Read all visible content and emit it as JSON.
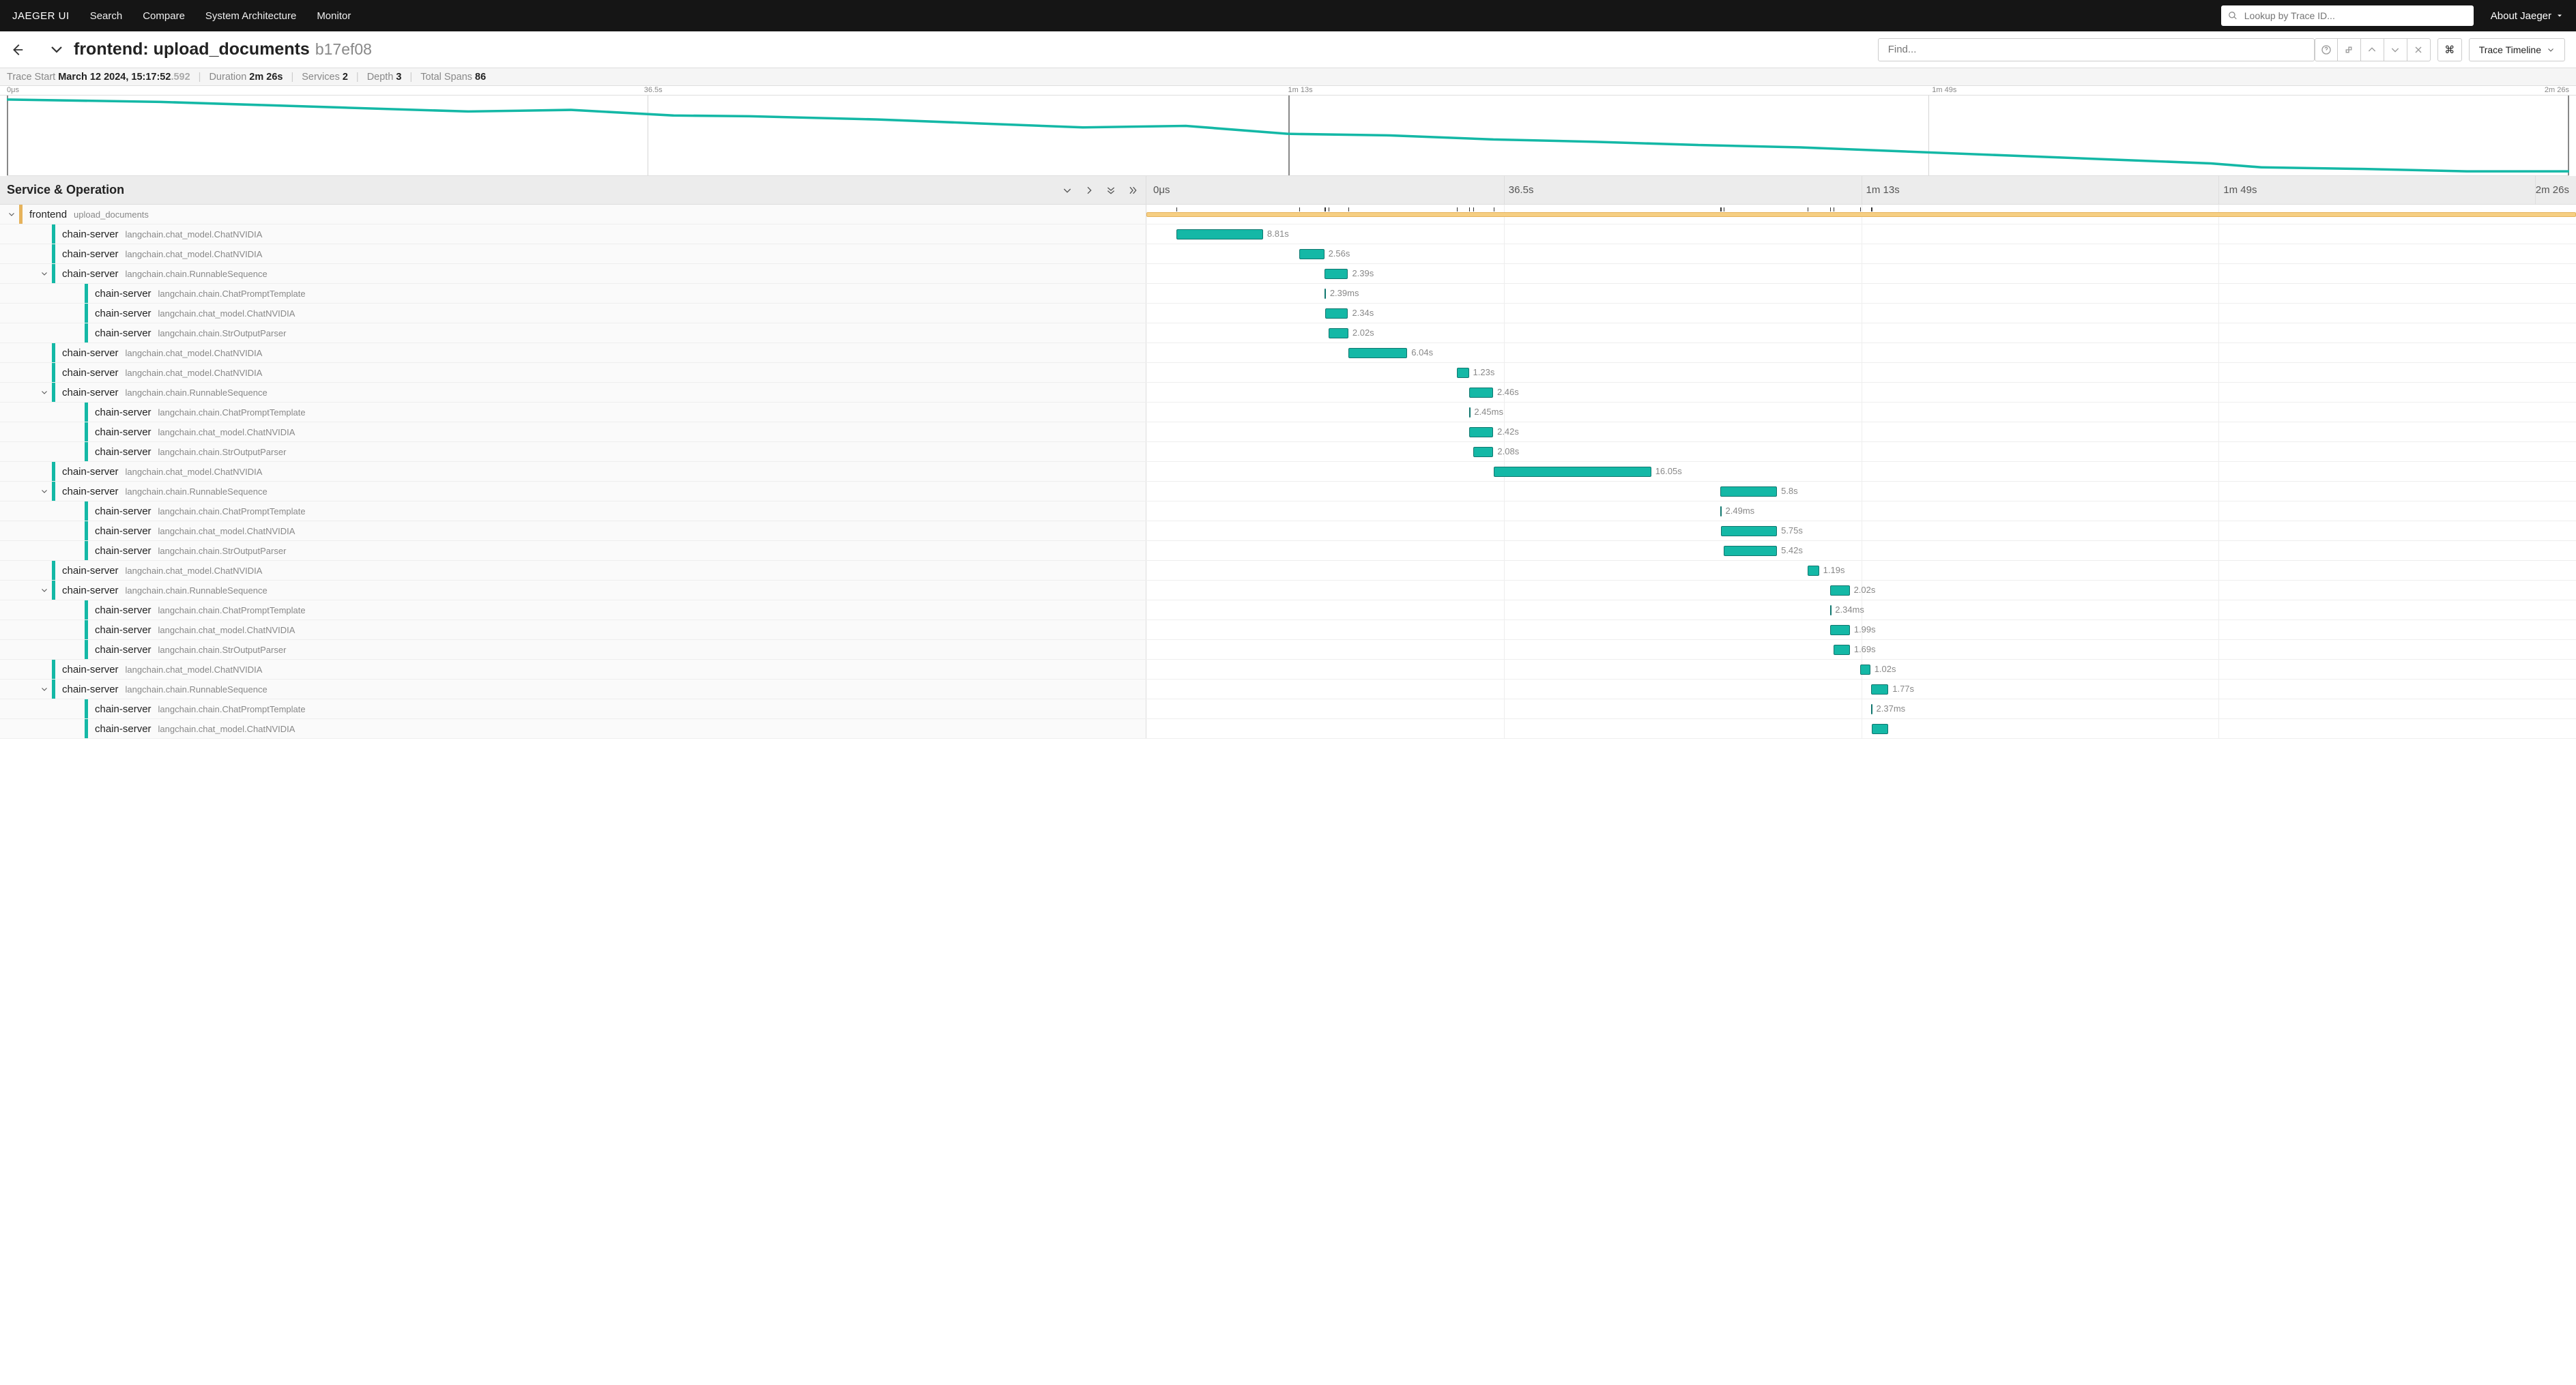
{
  "nav": {
    "brand": "JAEGER UI",
    "links": [
      "Search",
      "Compare",
      "System Architecture",
      "Monitor"
    ],
    "lookup_placeholder": "Lookup by Trace ID...",
    "about": "About Jaeger"
  },
  "title": {
    "text": "frontend: upload_documents",
    "trace_id": "b17ef08",
    "find_placeholder": "Find...",
    "kbd": "⌘",
    "dropdown": "Trace Timeline"
  },
  "stats": {
    "start_label": "Trace Start",
    "start_val": "March 12 2024, 15:17:52",
    "start_ms": ".592",
    "duration_label": "Duration",
    "duration_val": "2m 26s",
    "services_label": "Services",
    "services_val": "2",
    "depth_label": "Depth",
    "depth_val": "3",
    "spans_label": "Total Spans",
    "spans_val": "86"
  },
  "minimap_ticks": [
    "0μs",
    "36.5s",
    "1m 13s",
    "1m 49s",
    "2m 26s"
  ],
  "header": {
    "label": "Service & Operation",
    "ticks": [
      "0μs",
      "36.5s",
      "1m 13s",
      "1m 49s",
      "2m 26s"
    ]
  },
  "colors": {
    "frontend": "#e6b35c",
    "chain": "#14b8a6"
  },
  "total_ms": 146000,
  "spans": [
    {
      "depth": 0,
      "svc": "frontend",
      "op": "upload_documents",
      "color": "orange",
      "caret": "down",
      "start": 0,
      "dur": 146000,
      "label": "",
      "thin": true,
      "markers": true
    },
    {
      "depth": 1,
      "svc": "chain-server",
      "op": "langchain.chat_model.ChatNVIDIA",
      "color": "teal",
      "start": 3100,
      "dur": 8810,
      "label": "8.81s"
    },
    {
      "depth": 1,
      "svc": "chain-server",
      "op": "langchain.chat_model.ChatNVIDIA",
      "color": "teal",
      "start": 15600,
      "dur": 2560,
      "label": "2.56s"
    },
    {
      "depth": 1,
      "svc": "chain-server",
      "op": "langchain.chain.RunnableSequence",
      "color": "teal",
      "caret": "down",
      "start": 18200,
      "dur": 2390,
      "label": "2.39s"
    },
    {
      "depth": 2,
      "svc": "chain-server",
      "op": "langchain.chain.ChatPromptTemplate",
      "color": "teal",
      "start": 18200,
      "dur": 50,
      "label": "2.39ms"
    },
    {
      "depth": 2,
      "svc": "chain-server",
      "op": "langchain.chat_model.ChatNVIDIA",
      "color": "teal",
      "start": 18250,
      "dur": 2340,
      "label": "2.34s"
    },
    {
      "depth": 2,
      "svc": "chain-server",
      "op": "langchain.chain.StrOutputParser",
      "color": "teal",
      "start": 18600,
      "dur": 2020,
      "label": "2.02s"
    },
    {
      "depth": 1,
      "svc": "chain-server",
      "op": "langchain.chat_model.ChatNVIDIA",
      "color": "teal",
      "start": 20600,
      "dur": 6040,
      "label": "6.04s"
    },
    {
      "depth": 1,
      "svc": "chain-server",
      "op": "langchain.chat_model.ChatNVIDIA",
      "color": "teal",
      "start": 31700,
      "dur": 1230,
      "label": "1.23s"
    },
    {
      "depth": 1,
      "svc": "chain-server",
      "op": "langchain.chain.RunnableSequence",
      "color": "teal",
      "caret": "down",
      "start": 32940,
      "dur": 2460,
      "label": "2.46s"
    },
    {
      "depth": 2,
      "svc": "chain-server",
      "op": "langchain.chain.ChatPromptTemplate",
      "color": "teal",
      "start": 32940,
      "dur": 50,
      "label": "2.45ms"
    },
    {
      "depth": 2,
      "svc": "chain-server",
      "op": "langchain.chat_model.ChatNVIDIA",
      "color": "teal",
      "start": 32990,
      "dur": 2420,
      "label": "2.42s"
    },
    {
      "depth": 2,
      "svc": "chain-server",
      "op": "langchain.chain.StrOutputParser",
      "color": "teal",
      "start": 33350,
      "dur": 2080,
      "label": "2.08s"
    },
    {
      "depth": 1,
      "svc": "chain-server",
      "op": "langchain.chat_model.ChatNVIDIA",
      "color": "teal",
      "start": 35500,
      "dur": 16050,
      "label": "16.05s"
    },
    {
      "depth": 1,
      "svc": "chain-server",
      "op": "langchain.chain.RunnableSequence",
      "color": "teal",
      "caret": "down",
      "start": 58600,
      "dur": 5800,
      "label": "5.8s"
    },
    {
      "depth": 2,
      "svc": "chain-server",
      "op": "langchain.chain.ChatPromptTemplate",
      "color": "teal",
      "start": 58600,
      "dur": 50,
      "label": "2.49ms"
    },
    {
      "depth": 2,
      "svc": "chain-server",
      "op": "langchain.chat_model.ChatNVIDIA",
      "color": "teal",
      "start": 58650,
      "dur": 5750,
      "label": "5.75s"
    },
    {
      "depth": 2,
      "svc": "chain-server",
      "op": "langchain.chain.StrOutputParser",
      "color": "teal",
      "start": 58980,
      "dur": 5420,
      "label": "5.42s"
    },
    {
      "depth": 1,
      "svc": "chain-server",
      "op": "langchain.chat_model.ChatNVIDIA",
      "color": "teal",
      "start": 67500,
      "dur": 1190,
      "label": "1.19s"
    },
    {
      "depth": 1,
      "svc": "chain-server",
      "op": "langchain.chain.RunnableSequence",
      "color": "teal",
      "caret": "down",
      "start": 69800,
      "dur": 2020,
      "label": "2.02s"
    },
    {
      "depth": 2,
      "svc": "chain-server",
      "op": "langchain.chain.ChatPromptTemplate",
      "color": "teal",
      "start": 69800,
      "dur": 50,
      "label": "2.34ms"
    },
    {
      "depth": 2,
      "svc": "chain-server",
      "op": "langchain.chat_model.ChatNVIDIA",
      "color": "teal",
      "start": 69850,
      "dur": 1990,
      "label": "1.99s"
    },
    {
      "depth": 2,
      "svc": "chain-server",
      "op": "langchain.chain.StrOutputParser",
      "color": "teal",
      "start": 70150,
      "dur": 1690,
      "label": "1.69s"
    },
    {
      "depth": 1,
      "svc": "chain-server",
      "op": "langchain.chat_model.ChatNVIDIA",
      "color": "teal",
      "start": 72900,
      "dur": 1020,
      "label": "1.02s"
    },
    {
      "depth": 1,
      "svc": "chain-server",
      "op": "langchain.chain.RunnableSequence",
      "color": "teal",
      "caret": "down",
      "start": 74000,
      "dur": 1770,
      "label": "1.77s"
    },
    {
      "depth": 2,
      "svc": "chain-server",
      "op": "langchain.chain.ChatPromptTemplate",
      "color": "teal",
      "start": 74000,
      "dur": 50,
      "label": "2.37ms"
    },
    {
      "depth": 2,
      "svc": "chain-server",
      "op": "langchain.chat_model.ChatNVIDIA",
      "color": "teal",
      "start": 74050,
      "dur": 1720,
      "label": ""
    }
  ]
}
